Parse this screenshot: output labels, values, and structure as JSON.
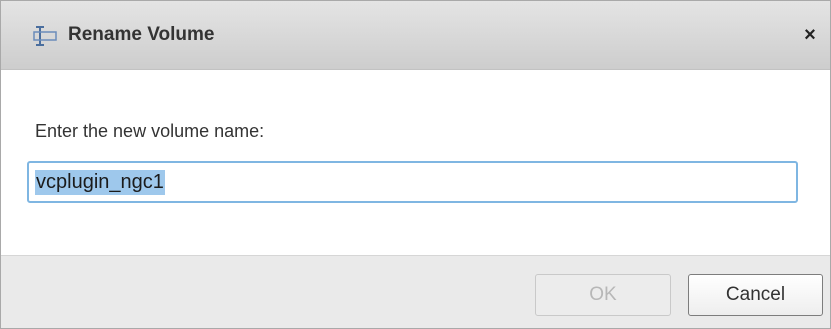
{
  "dialog": {
    "title": "Rename Volume",
    "title_icon": "rename-icon",
    "close_label": "×",
    "prompt": "Enter the new volume name:",
    "volume_name_value": "vcplugin_ngc1",
    "ok_label": "OK",
    "cancel_label": "Cancel",
    "ok_enabled": false
  }
}
